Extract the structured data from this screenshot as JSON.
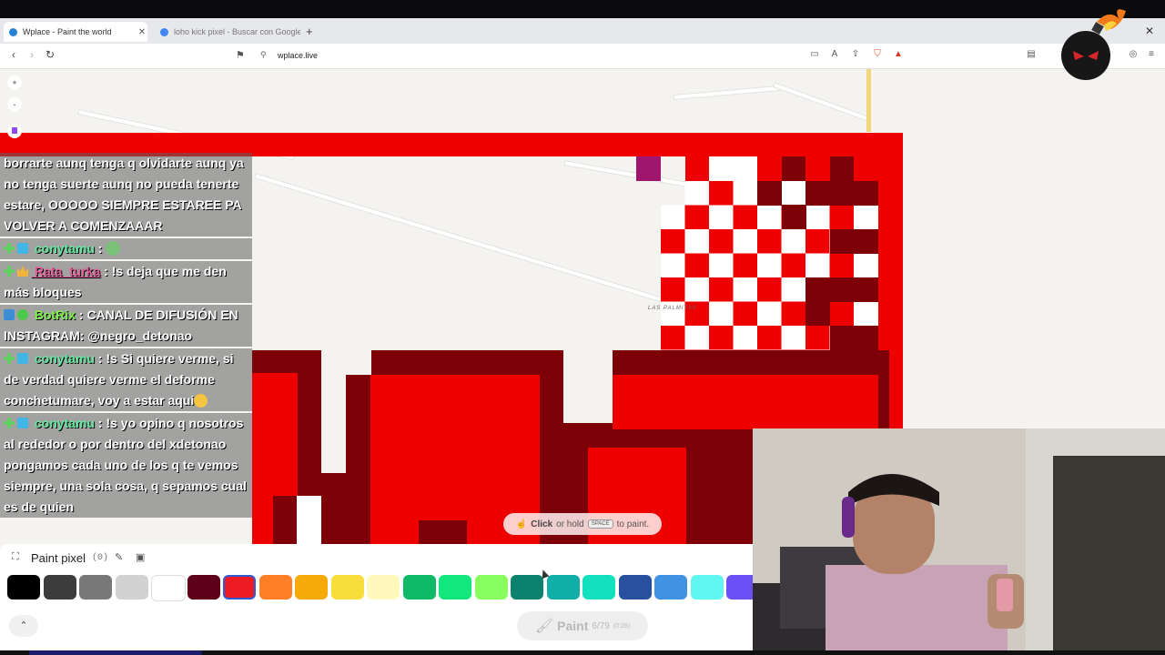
{
  "browser": {
    "tabs": [
      {
        "title": "Wplace - Paint the world",
        "active": true
      },
      {
        "title": "loho kick pixel - Buscar con Google",
        "active": false
      }
    ],
    "url": "wplace.live"
  },
  "map": {
    "zoom_in": "+",
    "zoom_out": "-",
    "label": "LAS PALMITAS"
  },
  "chat": {
    "messages": [
      {
        "user": "",
        "text": "borrarte aunq tenga q olvidarte aunq ya no tenga suerte aunq no pueda tenerte estare, OOOOO SIEMPRE ESTAREE PA VOLVER A COMENZAAAR"
      },
      {
        "user": "conytamu",
        "sep": " : ",
        "text": ""
      },
      {
        "user": "Rata_turka",
        "sep": " : ",
        "text": "!s deja que me den más bloques"
      },
      {
        "user": "BotRix",
        "sep": " : ",
        "text": "CANAL DE DIFUSIÓN EN INSTAGRAM: @negro_detonao"
      },
      {
        "user": "conytamu",
        "sep": " : ",
        "text": "!s Si quiere verme, si de verdad quiere verme el deforme conchetumare, voy a estar aqui"
      },
      {
        "user": "conytamu",
        "sep": " : ",
        "text": "!s yo opino q nosotros al rededor o por dentro del xdetonao pongamos cada uno de los q te vemos siempre, una sola cosa, q sepamos cual es de quien"
      }
    ]
  },
  "hint": {
    "click": "Click",
    "or_hold": "or hold",
    "key": "SPACE",
    "to_paint": "to paint."
  },
  "panel": {
    "title": "Paint pixel",
    "count": "(0)",
    "palette": [
      "#000000",
      "#3c3c3c",
      "#787878",
      "#d2d2d2",
      "#ffffff",
      "#600018",
      "#ed1c24",
      "#ff7f27",
      "#f6aa09",
      "#f9dd3b",
      "#fffabc",
      "#0eb968",
      "#13e67b",
      "#87ff5e",
      "#0c816e",
      "#10aea6",
      "#13e1be",
      "#28509e",
      "#4093e4",
      "#60f7f2",
      "#6b50f6"
    ],
    "selected_index": 6,
    "paint_button": {
      "label": "Paint",
      "count": "6/79",
      "timer": "(0:26)"
    }
  }
}
